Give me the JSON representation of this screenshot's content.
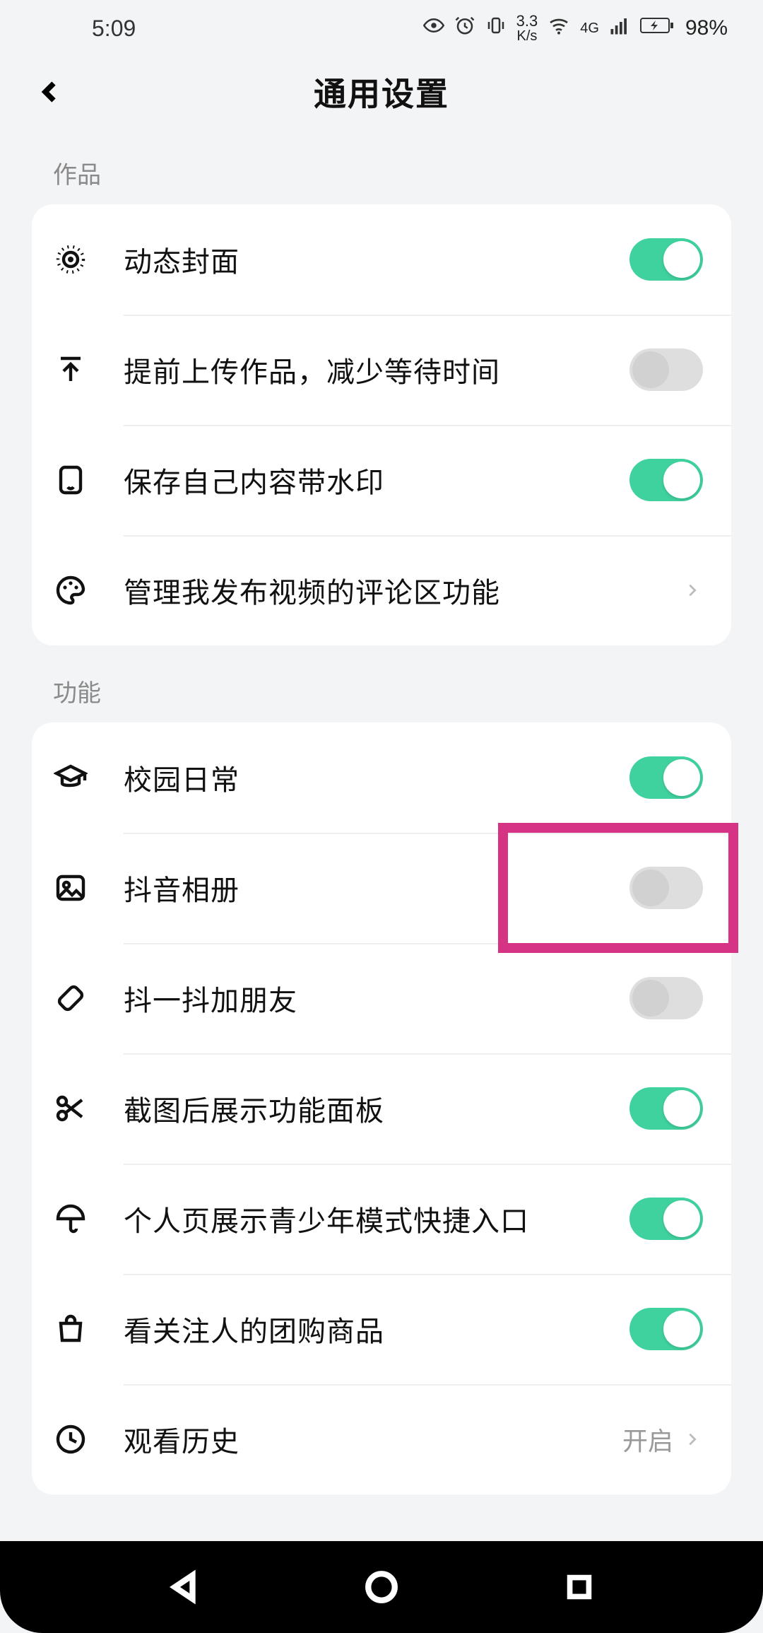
{
  "status": {
    "time": "5:09",
    "kbs_top": "3.3",
    "kbs_bot": "K/s",
    "net_label": "4G",
    "battery_pct": "98%"
  },
  "header": {
    "title": "通用设置"
  },
  "sections": [
    {
      "title": "作品",
      "items": [
        {
          "key": "dynamic-cover",
          "label": "动态封面",
          "type": "toggle",
          "on": true
        },
        {
          "key": "pre-upload",
          "label": "提前上传作品，减少等待时间",
          "type": "toggle",
          "on": false
        },
        {
          "key": "save-watermark",
          "label": "保存自己内容带水印",
          "type": "toggle",
          "on": true
        },
        {
          "key": "manage-comments",
          "label": "管理我发布视频的评论区功能",
          "type": "link"
        }
      ]
    },
    {
      "title": "功能",
      "items": [
        {
          "key": "campus-daily",
          "label": "校园日常",
          "type": "toggle",
          "on": true
        },
        {
          "key": "douyin-album",
          "label": "抖音相册",
          "type": "toggle",
          "on": false,
          "highlighted": true
        },
        {
          "key": "shake-friend",
          "label": "抖一抖加朋友",
          "type": "toggle",
          "on": false
        },
        {
          "key": "screenshot-panel",
          "label": "截图后展示功能面板",
          "type": "toggle",
          "on": true
        },
        {
          "key": "teen-shortcut",
          "label": "个人页展示青少年模式快捷入口",
          "type": "toggle",
          "on": true
        },
        {
          "key": "follow-groupbuy",
          "label": "看关注人的团购商品",
          "type": "toggle",
          "on": true
        },
        {
          "key": "watch-history",
          "label": "观看历史",
          "type": "link",
          "value": "开启"
        }
      ]
    }
  ]
}
